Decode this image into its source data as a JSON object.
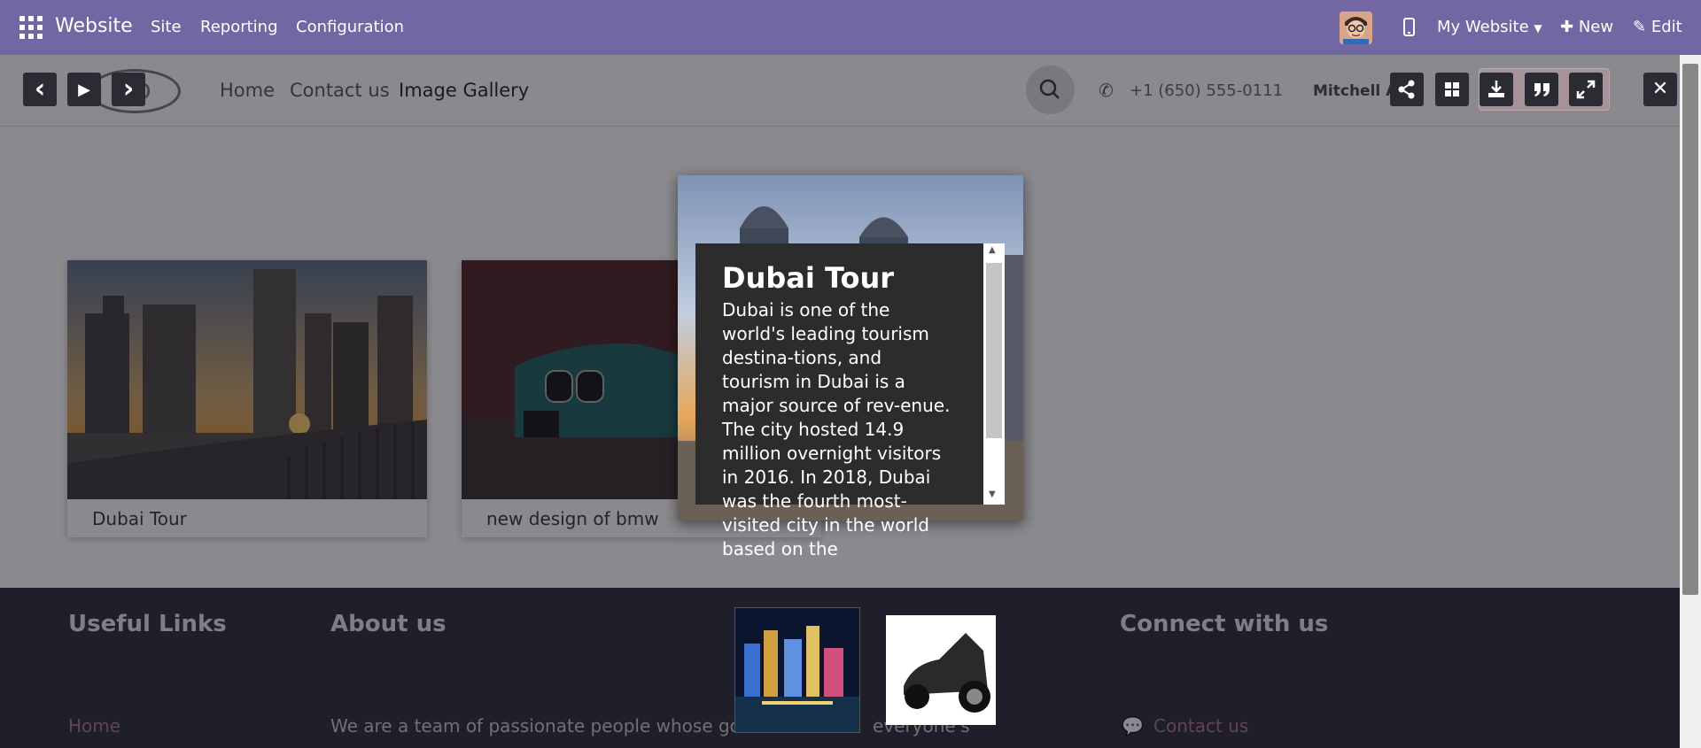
{
  "topbar": {
    "brand": "Website",
    "menu": [
      "Site",
      "Reporting",
      "Configuration"
    ],
    "my_website": "My Website",
    "new_label": "New",
    "edit_label": "Edit",
    "bg_color": "#7267a3"
  },
  "site": {
    "logo": "go",
    "nav": [
      "Home",
      "Contact us",
      "Image Gallery"
    ],
    "phone": "+1 (650) 555-0111",
    "user": "Mitchell A",
    "cards": [
      {
        "title": "Dubai Tour"
      },
      {
        "title": "new design of bmw"
      }
    ],
    "footer": {
      "useful_links_heading": "Useful Links",
      "useful_links_first": "Home",
      "about_heading": "About us",
      "about_text": "We are a team of passionate people whose goa",
      "about_text_tail": "everyone's",
      "connect_heading": "Connect with us",
      "contact_link": "Contact us"
    }
  },
  "lightbox": {
    "title": "Dubai Tour",
    "body": "Dubai is one of the world's leading tourism destina-tions, and tourism in Dubai is a major source of rev-enue. The city hosted 14.9 million overnight visitors in 2016. In 2018, Dubai was the fourth most-visited city in the world based on the",
    "controls": {
      "prev": "‹",
      "play": "▶",
      "next": "›",
      "share": "share-icon",
      "grid": "grid-icon",
      "download": "download-icon",
      "quote": "quote-icon",
      "fullscreen": "fullscreen-icon",
      "close": "✕"
    }
  }
}
